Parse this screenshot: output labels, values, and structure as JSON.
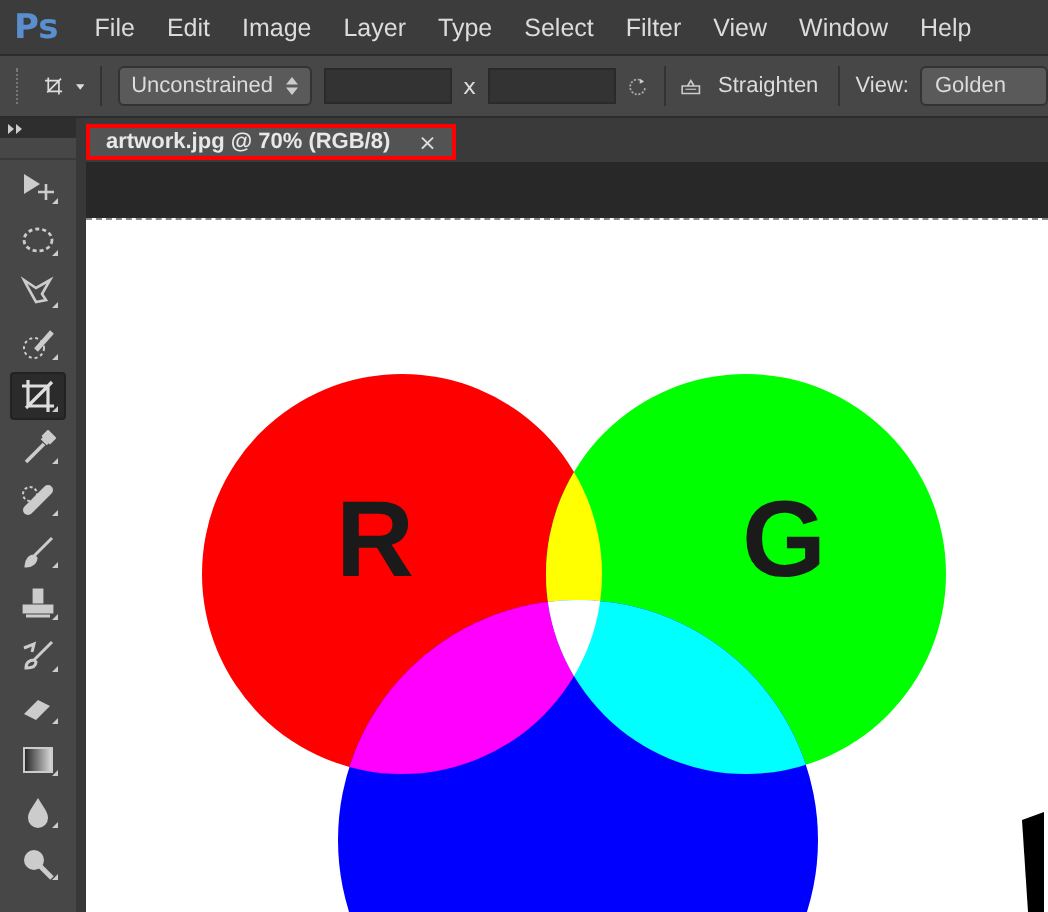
{
  "app": {
    "logo": "Ps"
  },
  "menu": [
    "File",
    "Edit",
    "Image",
    "Layer",
    "Type",
    "Select",
    "Filter",
    "View",
    "Window",
    "Help"
  ],
  "options_bar": {
    "ratio": "Unconstrained",
    "separator": "x",
    "straighten": "Straighten",
    "view_label": "View:",
    "view_value": "Golden"
  },
  "document_tab": {
    "title": "artwork.jpg @ 70% (RGB/8)",
    "close": "×",
    "highlighted": true
  },
  "tools": [
    {
      "kind": "move",
      "selected": false
    },
    {
      "kind": "marquee",
      "selected": false
    },
    {
      "kind": "lasso",
      "selected": false
    },
    {
      "kind": "quick-select",
      "selected": false
    },
    {
      "kind": "crop",
      "selected": true
    },
    {
      "kind": "eyedropper",
      "selected": false
    },
    {
      "kind": "healing",
      "selected": false
    },
    {
      "kind": "brush",
      "selected": false
    },
    {
      "kind": "stamp",
      "selected": false
    },
    {
      "kind": "history-brush",
      "selected": false
    },
    {
      "kind": "eraser",
      "selected": false
    },
    {
      "kind": "gradient",
      "selected": false
    },
    {
      "kind": "blur",
      "selected": false
    },
    {
      "kind": "dodge",
      "selected": false
    }
  ],
  "artwork": {
    "labels": [
      "R",
      "G"
    ]
  }
}
